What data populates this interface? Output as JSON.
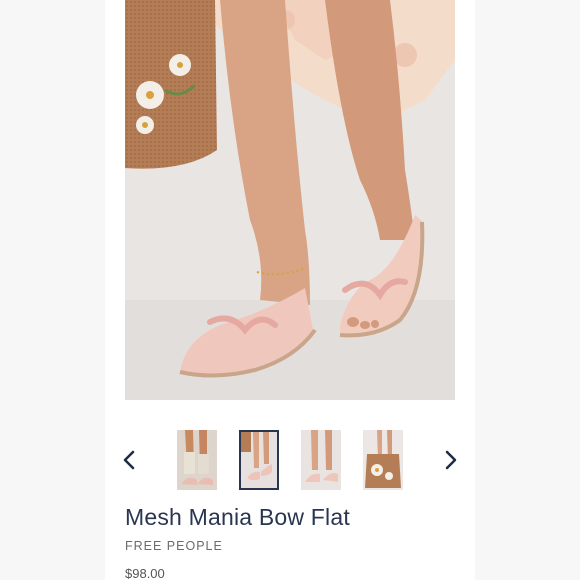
{
  "product": {
    "title": "Mesh Mania Bow Flat",
    "brand": "FREE PEOPLE",
    "price": "$98.00"
  },
  "hero_image": {
    "subject": "feet-in-pink-mesh-bow-flats"
  },
  "carousel": {
    "selected_index": 1,
    "thumbnails": [
      {
        "name": "thumbnail-socks-look"
      },
      {
        "name": "thumbnail-feet-bag"
      },
      {
        "name": "thumbnail-flats-closeup"
      },
      {
        "name": "thumbnail-beaded-bag"
      }
    ],
    "prev_icon": "chevron-left-icon",
    "next_icon": "chevron-right-icon"
  },
  "colors": {
    "title": "#2a3550",
    "selected_border": "#2a3550",
    "arrow": "#1f2a44"
  }
}
